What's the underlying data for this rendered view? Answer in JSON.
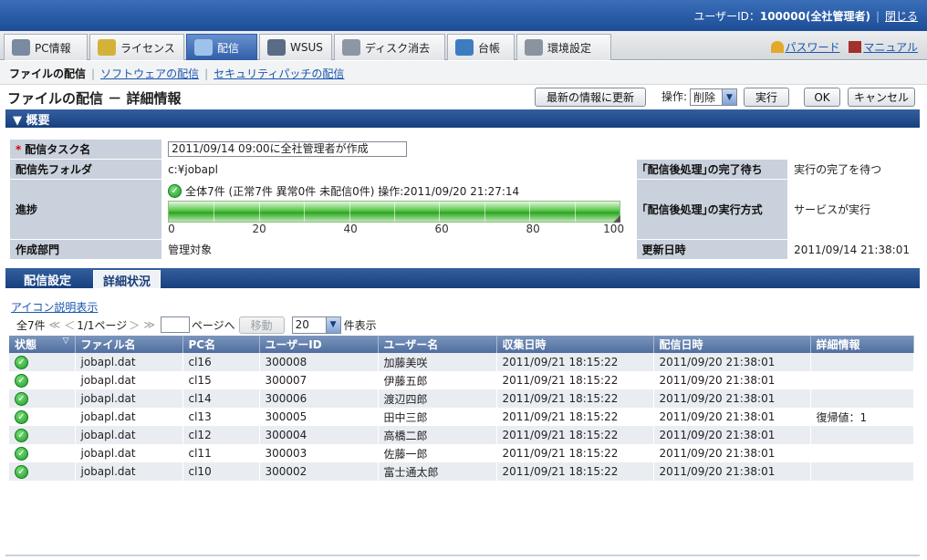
{
  "header": {
    "user_label": "ユーザーID：",
    "user_id": "100000(全社管理者)",
    "logout": "閉じる"
  },
  "tabs": [
    {
      "label": "PC情報",
      "icon": "pc-info-icon"
    },
    {
      "label": "ライセンス",
      "icon": "license-icon"
    },
    {
      "label": "配信",
      "icon": "distribution-icon",
      "active": true
    },
    {
      "label": "WSUS",
      "icon": "wsus-icon"
    },
    {
      "label": "ディスク消去",
      "icon": "disk-erase-icon"
    },
    {
      "label": "台帳",
      "icon": "ledger-icon"
    },
    {
      "label": "環境設定",
      "icon": "settings-icon"
    }
  ],
  "top_links": {
    "password": "パスワード",
    "manual": "マニュアル"
  },
  "subnav": {
    "current": "ファイルの配信",
    "link1": "ソフトウェアの配信",
    "link2": "セキュリティパッチの配信"
  },
  "page": {
    "title": "ファイルの配信 － 詳細情報",
    "refresh_button": "最新の情報に更新",
    "operation_label": "操作",
    "operation_value": "削除",
    "execute_button": "実行",
    "ok_button": "OK",
    "cancel_button": "キャンセル"
  },
  "overview": {
    "section_title": "▼ 概要",
    "task_name_label": "配信タスク名",
    "task_name_value": "2011/09/14 09:00に全社管理者が作成",
    "folder_label": "配信先フォルダ",
    "folder_value": "c:¥jobapl",
    "wait_label": "｢配信後処理｣の完了待ち",
    "wait_value": "実行の完了を待つ",
    "progress_label": "進捗",
    "progress_summary": "全体7件 (正常7件 異常0件 未配信0件) 操作:2011/09/20 21:27:14",
    "progress_percent": 100,
    "progress_scale": [
      "0",
      "20",
      "40",
      "60",
      "80",
      "100"
    ],
    "method_label": "｢配信後処理｣の実行方式",
    "method_value": "サービスが実行",
    "dept_label": "作成部門",
    "dept_value": "管理対象",
    "updated_label": "更新日時",
    "updated_value": "2011/09/14 21:38:01"
  },
  "detail_tabs": {
    "settings": "配信設定",
    "status": "詳細状況"
  },
  "icon_legend_link": "アイコン説明表示",
  "pager": {
    "total": "全7件",
    "first": "≪",
    "prev": "＜",
    "page_info": "1/1ページ",
    "next": "＞",
    "last": "≫",
    "goto_label": "ページへ",
    "move_button": "移動",
    "per_page": "20",
    "per_page_suffix": "件表示"
  },
  "table": {
    "columns": [
      "状態",
      "ファイル名",
      "PC名",
      "ユーザーID",
      "ユーザー名",
      "収集日時",
      "配信日時",
      "詳細情報"
    ],
    "rows": [
      [
        "ok",
        "jobapl.dat",
        "cl16",
        "300008",
        "加藤美咲",
        "2011/09/21 18:15:22",
        "2011/09/20 21:38:01",
        ""
      ],
      [
        "ok",
        "jobapl.dat",
        "cl15",
        "300007",
        "伊藤五郎",
        "2011/09/21 18:15:22",
        "2011/09/20 21:38:01",
        ""
      ],
      [
        "ok",
        "jobapl.dat",
        "cl14",
        "300006",
        "渡辺四郎",
        "2011/09/21 18:15:22",
        "2011/09/20 21:38:01",
        ""
      ],
      [
        "ok",
        "jobapl.dat",
        "cl13",
        "300005",
        "田中三郎",
        "2011/09/21 18:15:22",
        "2011/09/20 21:38:01",
        "復帰値：1"
      ],
      [
        "ok",
        "jobapl.dat",
        "cl12",
        "300004",
        "高橋二郎",
        "2011/09/21 18:15:22",
        "2011/09/20 21:38:01",
        ""
      ],
      [
        "ok",
        "jobapl.dat",
        "cl11",
        "300003",
        "佐藤一郎",
        "2011/09/21 18:15:22",
        "2011/09/20 21:38:01",
        ""
      ],
      [
        "ok",
        "jobapl.dat",
        "cl10",
        "300002",
        "富士通太郎",
        "2011/09/21 18:15:22",
        "2011/09/20 21:38:01",
        ""
      ]
    ]
  },
  "colors": {
    "accent": "#1d4d97",
    "success": "#2aa61f",
    "link": "#1a56b0"
  }
}
